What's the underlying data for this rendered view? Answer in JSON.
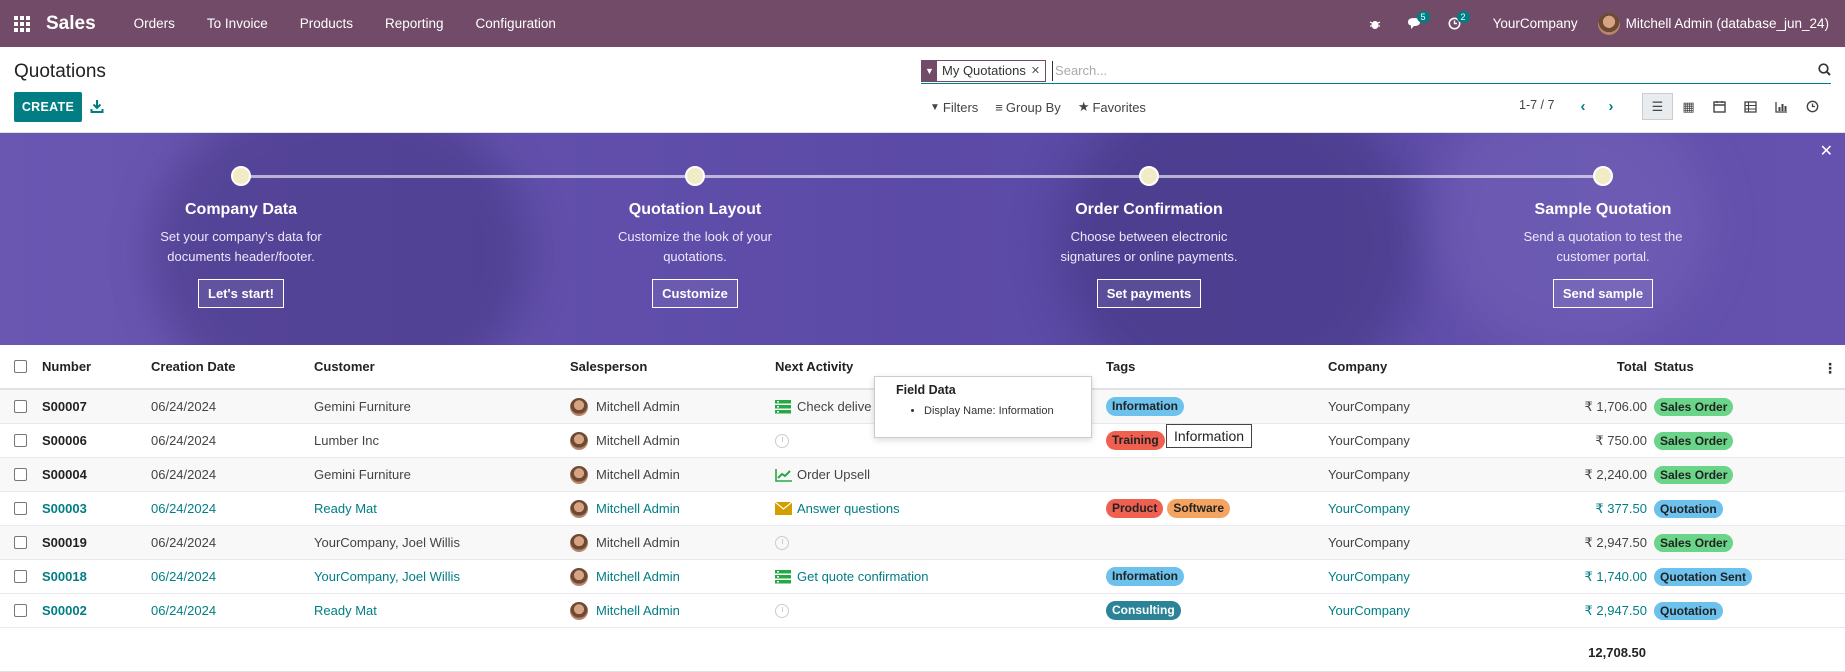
{
  "topbar": {
    "app_name": "Sales",
    "menu": [
      "Orders",
      "To Invoice",
      "Products",
      "Reporting",
      "Configuration"
    ],
    "chat_badge": "5",
    "activity_badge": "2",
    "company": "YourCompany",
    "user": "Mitchell Admin (database_jun_24)"
  },
  "control_panel": {
    "title": "Quotations",
    "create_label": "CREATE",
    "facet_value": "My Quotations",
    "search_placeholder": "Search...",
    "filters_label": "Filters",
    "groupby_label": "Group By",
    "favorites_label": "Favorites",
    "pager": "1-7 / 7"
  },
  "banner": {
    "steps": [
      {
        "title": "Company Data",
        "desc": "Set your company's data for documents header/footer.",
        "button": "Let's start!"
      },
      {
        "title": "Quotation Layout",
        "desc": "Customize the look of your quotations.",
        "button": "Customize"
      },
      {
        "title": "Order Confirmation",
        "desc": "Choose between electronic signatures or online payments.",
        "button": "Set payments"
      },
      {
        "title": "Sample Quotation",
        "desc": "Send a quotation to test the customer portal.",
        "button": "Send sample"
      }
    ]
  },
  "table": {
    "headers": {
      "number": "Number",
      "date": "Creation Date",
      "customer": "Customer",
      "salesperson": "Salesperson",
      "activity": "Next Activity",
      "tags": "Tags",
      "company": "Company",
      "total": "Total",
      "status": "Status"
    },
    "rows": [
      {
        "number": "S00007",
        "date": "06/24/2024",
        "customer": "Gemini Furniture",
        "salesperson": "Mitchell Admin",
        "activity": "Check delive",
        "tags": [
          "Information"
        ],
        "company": "YourCompany",
        "total": "₹ 1,706.00",
        "status": "Sales Order"
      },
      {
        "number": "S00006",
        "date": "06/24/2024",
        "customer": "Lumber Inc",
        "salesperson": "Mitchell Admin",
        "activity": "",
        "tags": [
          "Training"
        ],
        "company": "YourCompany",
        "total": "₹ 750.00",
        "status": "Sales Order"
      },
      {
        "number": "S00004",
        "date": "06/24/2024",
        "customer": "Gemini Furniture",
        "salesperson": "Mitchell Admin",
        "activity": "Order Upsell",
        "tags": [],
        "company": "YourCompany",
        "total": "₹ 2,240.00",
        "status": "Sales Order"
      },
      {
        "number": "S00003",
        "date": "06/24/2024",
        "customer": "Ready Mat",
        "salesperson": "Mitchell Admin",
        "activity": "Answer questions",
        "tags": [
          "Product",
          "Software"
        ],
        "company": "YourCompany",
        "total": "₹ 377.50",
        "status": "Quotation"
      },
      {
        "number": "S00019",
        "date": "06/24/2024",
        "customer": "YourCompany, Joel Willis",
        "salesperson": "Mitchell Admin",
        "activity": "",
        "tags": [],
        "company": "YourCompany",
        "total": "₹ 2,947.50",
        "status": "Sales Order"
      },
      {
        "number": "S00018",
        "date": "06/24/2024",
        "customer": "YourCompany, Joel Willis",
        "salesperson": "Mitchell Admin",
        "activity": "Get quote confirmation",
        "tags": [
          "Information"
        ],
        "company": "YourCompany",
        "total": "₹ 1,740.00",
        "status": "Quotation Sent"
      },
      {
        "number": "S00002",
        "date": "06/24/2024",
        "customer": "Ready Mat",
        "salesperson": "Mitchell Admin",
        "activity": "",
        "tags": [
          "Consulting"
        ],
        "company": "YourCompany",
        "total": "₹ 2,947.50",
        "status": "Quotation"
      }
    ],
    "grand_total": "12,708.50"
  },
  "tooltip": {
    "title": "Field Data",
    "item": "Display Name: Information",
    "native": "Information"
  },
  "colors": {
    "brand": "#714b67",
    "accent": "#017e84",
    "tag_information": "#6cc1ed",
    "tag_training": "#f06050",
    "tag_product": "#f06050",
    "tag_software": "#f4a460",
    "tag_consulting": "#2c8397",
    "status_sales_order": "#6ad588",
    "status_quotation": "#6cc1ed"
  }
}
